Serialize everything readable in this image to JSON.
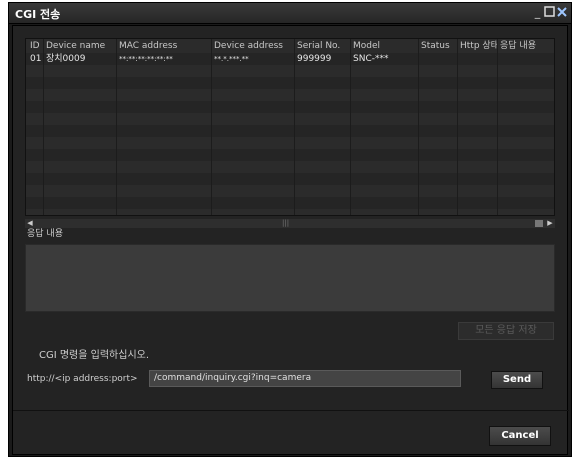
{
  "window": {
    "title": "CGI 전송"
  },
  "table": {
    "columns": [
      "ID",
      "Device name",
      "MAC address",
      "Device address",
      "Serial No.",
      "Model",
      "Status",
      "Http 상태",
      "응답 내용"
    ],
    "rows": [
      [
        "01",
        "장치0009",
        "**:**:**:**:**:**",
        "**.*.***.**",
        "999999",
        "SNC-***",
        "",
        "",
        ""
      ]
    ]
  },
  "response": {
    "label": "응답 내용"
  },
  "save_all_label": "모든 응답 저장",
  "command": {
    "prompt": "CGI 명령을 입력하십시오.",
    "prefix": "http://<ip address:port>",
    "value": "/command/inquiry.cgi?inq=camera"
  },
  "send_label": "Send",
  "cancel_label": "Cancel"
}
